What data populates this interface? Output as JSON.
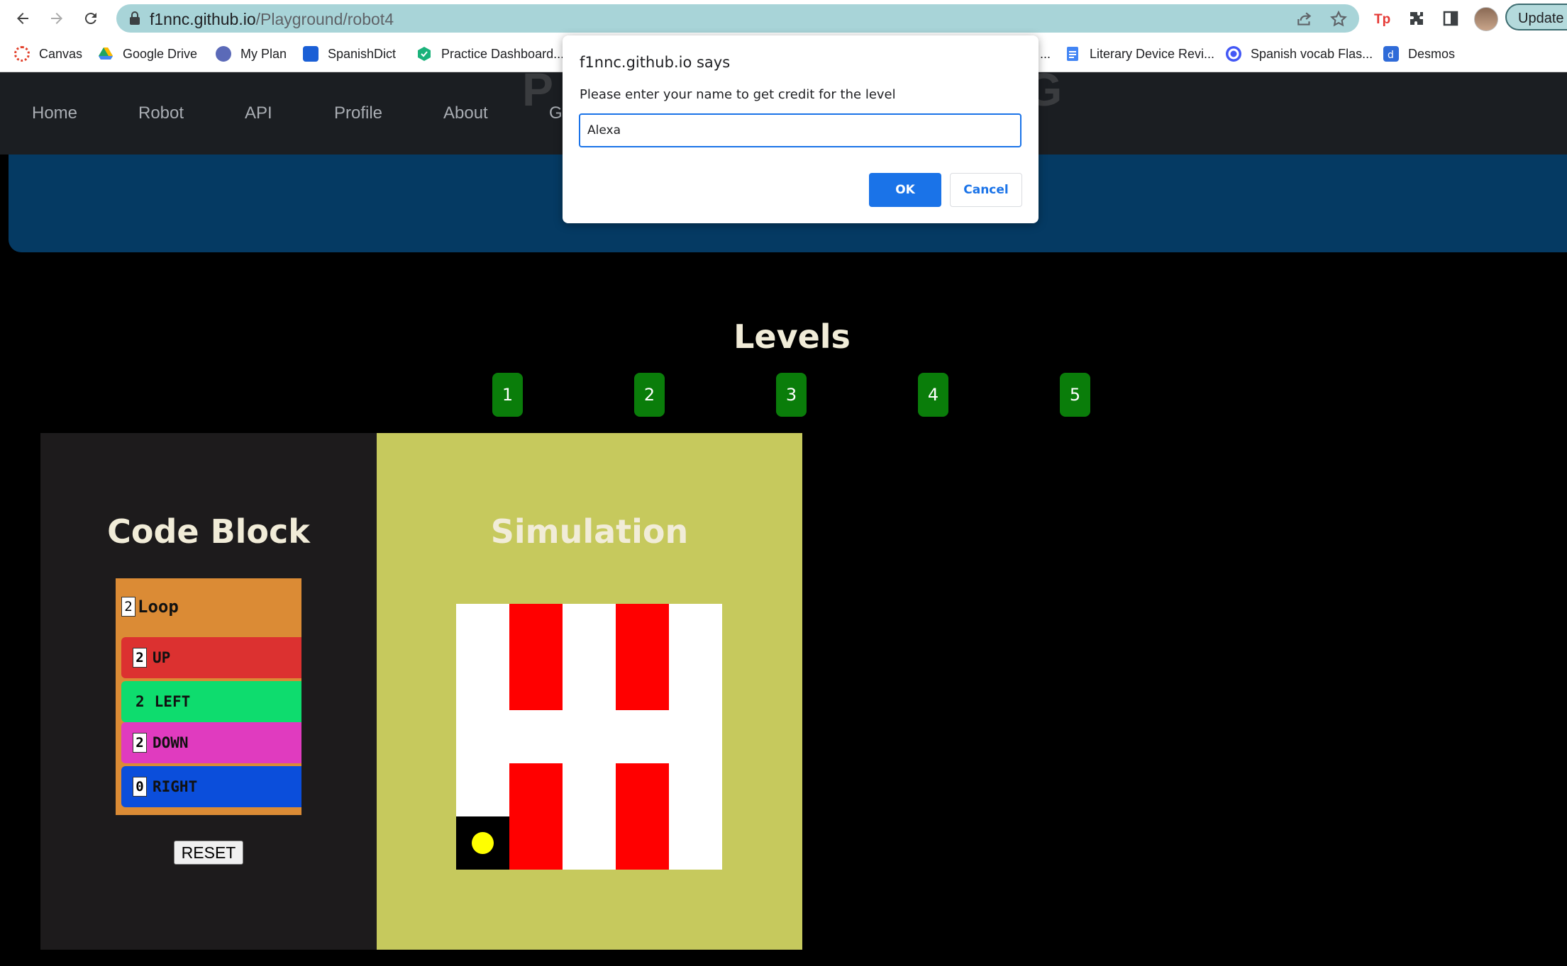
{
  "browser": {
    "url_host": "f1nnc.github.io",
    "url_path": "/Playground/robot4",
    "update_label": "Update",
    "bookmarks": [
      {
        "label": "Canvas",
        "color": "#e2402b"
      },
      {
        "label": "Google Drive",
        "color": "#1fa463"
      },
      {
        "label": "My Plan",
        "color": "#5b6ab8"
      },
      {
        "label": "SpanishDict",
        "color": "#1a5fd6"
      },
      {
        "label": "Practice Dashboard...",
        "color": "#1bb27b"
      },
      {
        "label": "Literary Device Revi...",
        "color": "#4285f4"
      },
      {
        "label": "Spanish vocab Flas...",
        "color": "#4257f5"
      },
      {
        "label": "Desmos",
        "color": "#2f6bd8"
      }
    ],
    "bookmark_ellipsis": "..."
  },
  "site": {
    "nav": [
      "Home",
      "Robot",
      "API",
      "Profile",
      "About",
      "G"
    ],
    "title_partial_left": "P",
    "title_partial_right": "G"
  },
  "levels": {
    "title": "Levels",
    "buttons": [
      "1",
      "2",
      "3",
      "4",
      "5"
    ]
  },
  "code_block": {
    "title": "Code Block",
    "loop": {
      "count": "2",
      "label": "Loop"
    },
    "commands": [
      {
        "count": "2",
        "label": "UP",
        "color": "#dc3130",
        "boxed": true
      },
      {
        "count": "2",
        "label": "LEFT",
        "color": "#0edc6e",
        "boxed": false
      },
      {
        "count": "2",
        "label": "DOWN",
        "color": "#e03bbf",
        "boxed": true
      },
      {
        "count": "0",
        "label": "RIGHT",
        "color": "#0b4edb",
        "boxed": true
      }
    ],
    "reset_label": "RESET"
  },
  "simulation": {
    "title": "Simulation",
    "grid": {
      "rows": 5,
      "cols": 5,
      "walls": [
        [
          0,
          1
        ],
        [
          1,
          1
        ],
        [
          0,
          3
        ],
        [
          1,
          3
        ],
        [
          3,
          1
        ],
        [
          4,
          1
        ],
        [
          3,
          3
        ],
        [
          4,
          3
        ]
      ],
      "robot_cell": [
        4,
        0
      ]
    },
    "wall_color": "#ff0000",
    "robot_color": "#ffff00"
  },
  "dialog": {
    "title": "f1nnc.github.io says",
    "message": "Please enter your name to get credit for the level",
    "input_value": "Alexa",
    "ok_label": "OK",
    "cancel_label": "Cancel"
  }
}
